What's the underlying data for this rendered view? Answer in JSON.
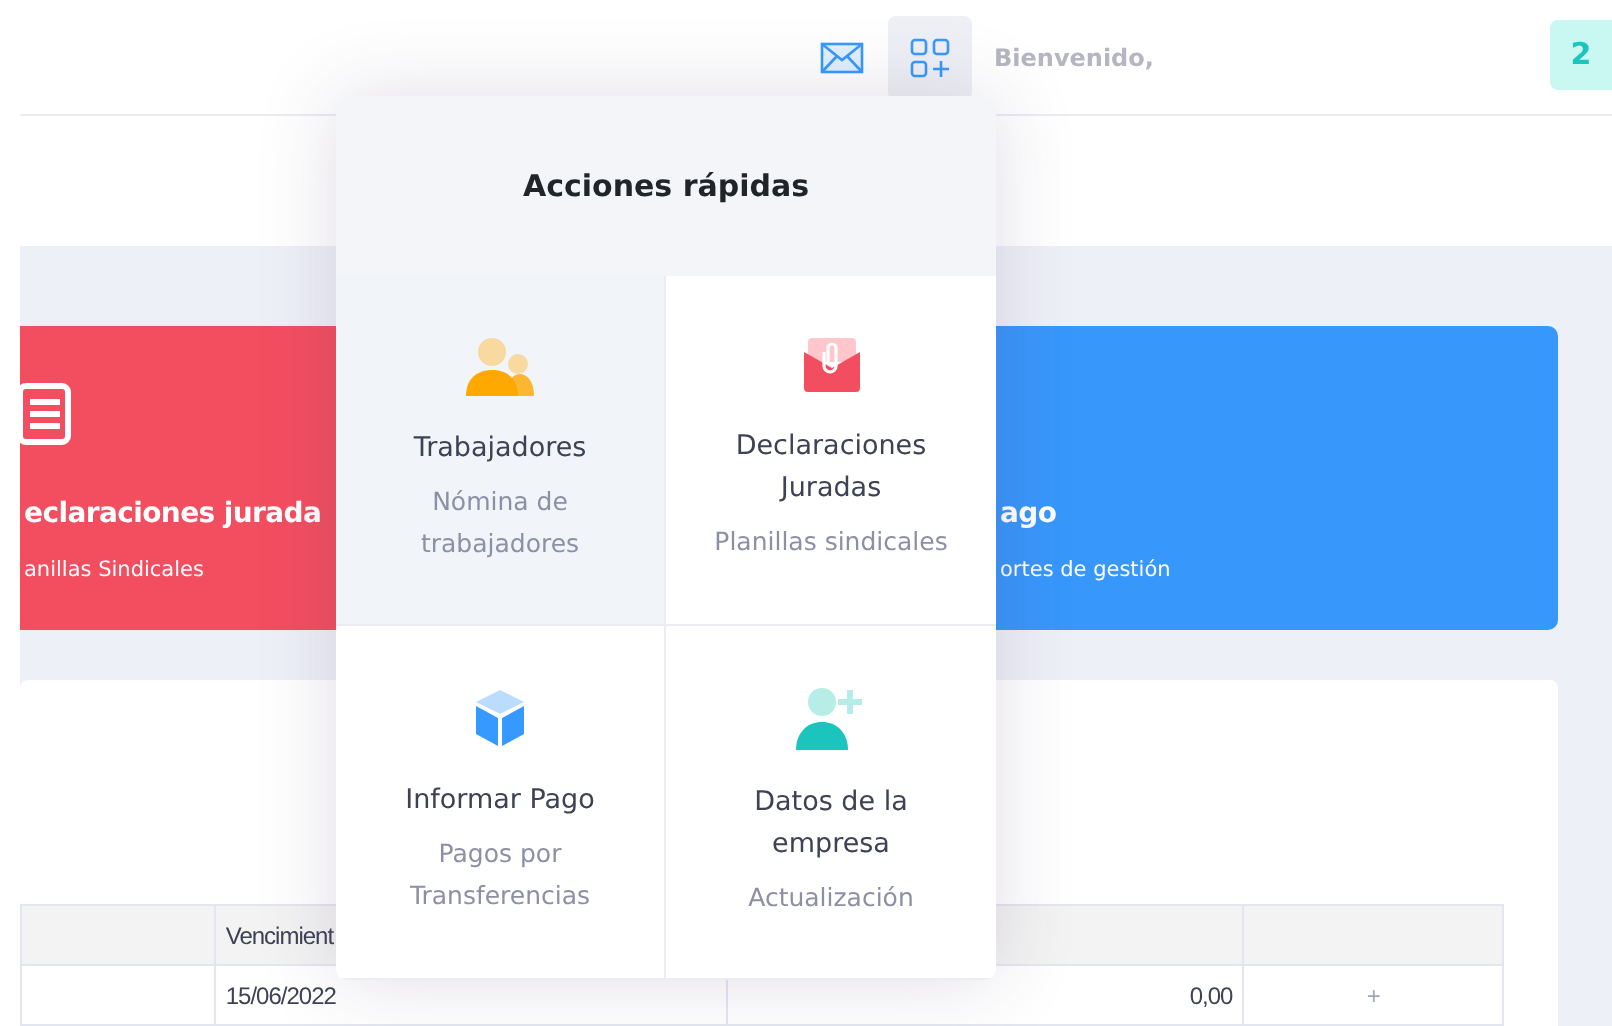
{
  "header": {
    "greeting": "Bienvenido,",
    "badge": "2"
  },
  "stat_cards": [
    {
      "title": "eclaraciones jurada",
      "subtitle": "anillas Sindicales",
      "color": "#f34e60"
    },
    {
      "title": "ago",
      "subtitle": "ortes de gestión",
      "color": "#3897fb"
    }
  ],
  "table": {
    "columns": [
      "",
      "Vencimient",
      "",
      ""
    ],
    "rows": [
      [
        "",
        "15/06/2022",
        "0,00",
        "+"
      ]
    ]
  },
  "quick_actions": {
    "title": "Acciones rápidas",
    "items": [
      {
        "title": "Trabajadores",
        "subtitle": "Nómina de trabajadores",
        "selected": true
      },
      {
        "title": "Declaraciones Juradas",
        "subtitle": "Planillas sindicales",
        "selected": false
      },
      {
        "title": "Informar Pago",
        "subtitle": "Pagos por Transferencias",
        "selected": false
      },
      {
        "title": "Datos de la empresa",
        "subtitle": "Actualización",
        "selected": false
      }
    ]
  }
}
